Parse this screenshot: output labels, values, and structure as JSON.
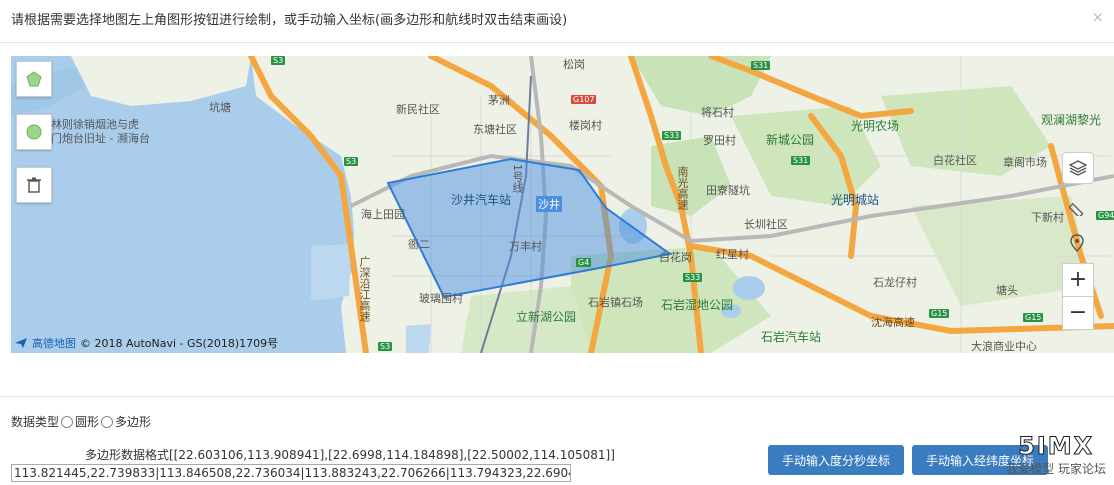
{
  "header": {
    "title": "请根据需要选择地图左上角图形按钮进行绘制，或手动输入坐标(画多边形和航线时双击结束画设)",
    "close": "×"
  },
  "map": {
    "attribution_logo": "高德地图",
    "attribution": "© 2018 AutoNavi - GS(2018)1709号",
    "labels": {
      "place1": "林则徐销烟池与虎",
      "place2": "门炮台旧址 - 濒海台",
      "place3": "坑塘",
      "place4": "新民社区",
      "place5": "茅洲",
      "place6": "东塘社区",
      "place7": "松岗",
      "place8": "楼岗村",
      "place9": "沙井汽车站",
      "place10": "沙井",
      "place11": "海上田园",
      "place12": "万丰村",
      "place13": "衙二",
      "place14": "玻璃围村",
      "place15": "立新湖公园",
      "place16": "石岩湿地公园",
      "place17": "石岩汽车站",
      "place18": "光明农场",
      "place19": "新城公园",
      "place20": "光明城站",
      "place21": "章阁市场",
      "place22": "观澜湖黎光",
      "place23": "白花社区",
      "place24": "罗田村",
      "place25": "田寮隧坑",
      "place26": "长圳社区",
      "place27": "红星村",
      "place28": "白花岗",
      "place29": "石龙仔村",
      "place30": "大浪商业中心",
      "place31": "塘头",
      "place32": "下新村",
      "place33": "将石村",
      "place34": "石岩镇石场",
      "road1": "广深沿江高速",
      "road2": "南光高速",
      "road3": "沈海高速",
      "road4": "1号线"
    },
    "road_tags": [
      "S3",
      "S3",
      "S33",
      "S33",
      "S31",
      "S31",
      "G4",
      "G107",
      "G15",
      "G15",
      "S3",
      "G94"
    ]
  },
  "data_type": {
    "label": "数据类型",
    "option1": "圆形",
    "option2": "多边形"
  },
  "format": {
    "label": "多边形数据格式[[22.603106,113.908941],[22.6998,114.184898],[22.50002,114.105081]]"
  },
  "coords": {
    "value": "113.821445,22.739833|113.846508,22.736034|113.883243,22.706266|113.794323,22.690429|1"
  },
  "buttons": {
    "dms": "手动输入度分秒坐标",
    "lnglat": "手动输入经纬度坐标"
  },
  "watermark": {
    "line1": "5IMX",
    "line2": "我爱模型 玩家论坛"
  },
  "colors": {
    "primary_button": "#3a7cc0",
    "polygon_fill": "#4a90e2",
    "water": "#a9cdea",
    "highway": "#f4a640"
  }
}
